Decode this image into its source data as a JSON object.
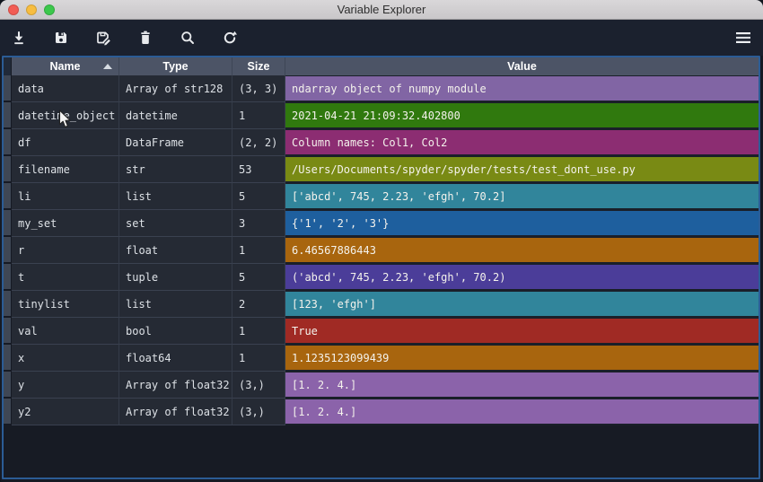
{
  "window": {
    "title": "Variable Explorer"
  },
  "titlebar": {
    "buttons": [
      "close-button",
      "minimize-button",
      "zoom-button"
    ]
  },
  "toolbar": {
    "icons": [
      "import-data-icon",
      "save-data-icon",
      "save-data-as-icon",
      "remove-variable-icon",
      "search-icon",
      "refresh-icon",
      "options-menu-icon"
    ],
    "icon_color": "#e8eaed"
  },
  "table": {
    "columns": [
      {
        "label": "Name",
        "sorted": "ascending"
      },
      {
        "label": "Type"
      },
      {
        "label": "Size"
      },
      {
        "label": "Value"
      }
    ],
    "rows": [
      {
        "name": "data",
        "type": "Array of str128",
        "size": "(3, 3)",
        "value": "ndarray object of numpy module",
        "color": "#8165a4"
      },
      {
        "name": "datetime_object",
        "type": "datetime",
        "size": "1",
        "value": "2021-04-21 21:09:32.402800",
        "color": "#30790e"
      },
      {
        "name": "df",
        "type": "DataFrame",
        "size": "(2, 2)",
        "value": "Column names: Col1, Col2",
        "color": "#8c2d72"
      },
      {
        "name": "filename",
        "type": "str",
        "size": "53",
        "value": "/Users/Documents/spyder/spyder/tests/test_dont_use.py",
        "color": "#798a14"
      },
      {
        "name": "li",
        "type": "list",
        "size": "5",
        "value": "['abcd', 745, 2.23, 'efgh', 70.2]",
        "color": "#31859b"
      },
      {
        "name": "my_set",
        "type": "set",
        "size": "3",
        "value": "{'1', '2', '3'}",
        "color": "#1e5f9e"
      },
      {
        "name": "r",
        "type": "float",
        "size": "1",
        "value": "6.46567886443",
        "color": "#a8650e"
      },
      {
        "name": "t",
        "type": "tuple",
        "size": "5",
        "value": "('abcd', 745, 2.23, 'efgh', 70.2)",
        "color": "#4b3d99"
      },
      {
        "name": "tinylist",
        "type": "list",
        "size": "2",
        "value": "[123, 'efgh']",
        "color": "#31859b"
      },
      {
        "name": "val",
        "type": "bool",
        "size": "1",
        "value": "True",
        "color": "#a02a24"
      },
      {
        "name": "x",
        "type": "float64",
        "size": "1",
        "value": "1.1235123099439",
        "color": "#a8650e"
      },
      {
        "name": "y",
        "type": "Array of float32",
        "size": "(3,)",
        "value": "[1. 2. 4.]",
        "color": "#8b63aa"
      },
      {
        "name": "y2",
        "type": "Array of float32",
        "size": "(3,)",
        "value": "[1. 2. 4.]",
        "color": "#8b63aa"
      }
    ]
  },
  "colors": {
    "toolbar_bg": "#1b212e",
    "content_bg": "#161a24",
    "header_bg": "#4c5466",
    "cell_bg": "#252a34",
    "focus_border": "#2b5c95",
    "titlebar_bg": "#d2d0d2"
  }
}
